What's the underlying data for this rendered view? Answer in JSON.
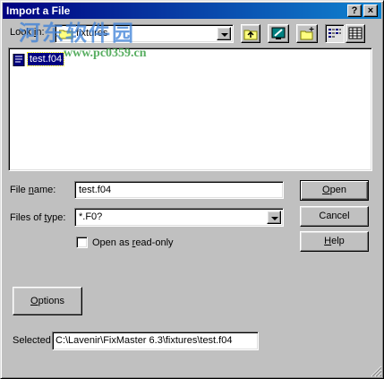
{
  "window": {
    "title": "Import a File",
    "help_btn": "?",
    "close_btn": "×"
  },
  "look_in": {
    "label_prefix": "Look ",
    "label_accel": "i",
    "label_suffix": "n:",
    "value": "fixtures"
  },
  "toolbar": {
    "up_folder": "up-folder-icon",
    "desktop": "desktop-icon",
    "new_folder": "new-folder-icon",
    "list_view": "list-view-icon",
    "details_view": "details-view-icon"
  },
  "files": [
    {
      "name": "test.f04",
      "selected": true
    }
  ],
  "file_name": {
    "label_prefix": "File ",
    "label_accel": "n",
    "label_suffix": "ame:",
    "value": "test.f04"
  },
  "file_type": {
    "label_prefix": "Files of ",
    "label_accel": "t",
    "label_suffix": "ype:",
    "value": "*.F0?"
  },
  "readonly": {
    "label_prefix": "Open as ",
    "label_accel": "r",
    "label_suffix": "ead-only",
    "checked": false
  },
  "buttons": {
    "open_accel": "O",
    "open_rest": "pen",
    "cancel": "Cancel",
    "help_accel": "H",
    "help_rest": "elp",
    "options_accel": "O",
    "options_rest": "ptions"
  },
  "selected": {
    "label": "Selected",
    "value": "C:\\Lavenir\\FixMaster 6.3\\fixtures\\test.f04"
  },
  "watermark": {
    "text1": "河东软件园",
    "text2": "www.pc0359.cn"
  },
  "colors": {
    "title_start": "#000080",
    "title_end": "#1084d0",
    "selection": "#000080",
    "face": "#c0c0c0"
  }
}
